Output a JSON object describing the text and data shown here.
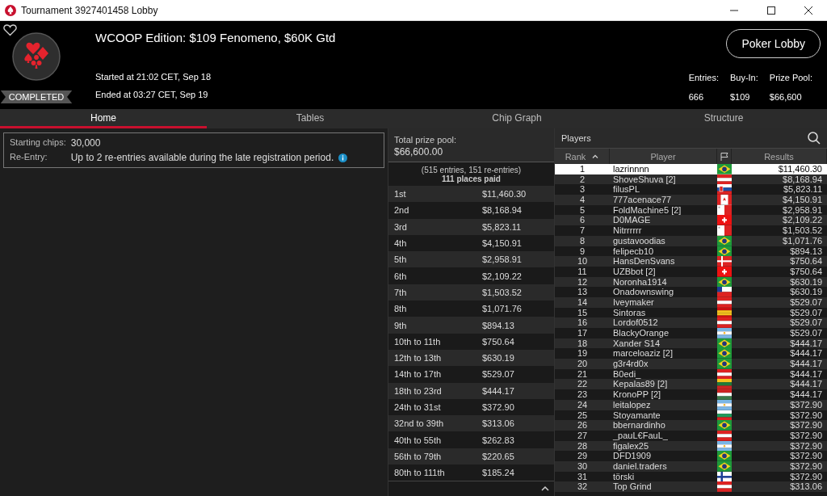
{
  "window": {
    "title": "Tournament 3927401458 Lobby"
  },
  "header": {
    "title": "WCOOP Edition: $109 Fenomeno, $60K Gtd",
    "status": "COMPLETED",
    "started": "Started at 21:02 CET, Sep 18",
    "ended": "Ended at 03:27 CET, Sep 19",
    "lobby_button": "Poker Lobby",
    "favorite": false,
    "stats": [
      {
        "label": "Entries:",
        "value": "666"
      },
      {
        "label": "Buy-In:",
        "value": "$109"
      },
      {
        "label": "Prize Pool:",
        "value": "$66,600"
      }
    ]
  },
  "tabs": [
    {
      "label": "Home",
      "selected": true
    },
    {
      "label": "Tables",
      "selected": false
    },
    {
      "label": "Chip Graph",
      "selected": false
    },
    {
      "label": "Structure",
      "selected": false
    }
  ],
  "info": [
    {
      "label": "Starting chips:",
      "value": "30,000",
      "info": false
    },
    {
      "label": "Re-Entry:",
      "value": "Up to 2 re-entries available during the late registration period.",
      "info": true
    }
  ],
  "prizes": {
    "total_label": "Total prize pool:",
    "total": "$66,600.00",
    "entries_note": "(515 entries, 151 re-entries)",
    "places_paid": "111 places paid",
    "rows": [
      {
        "place": "1st",
        "amount": "$11,460.30"
      },
      {
        "place": "2nd",
        "amount": "$8,168.94"
      },
      {
        "place": "3rd",
        "amount": "$5,823.11"
      },
      {
        "place": "4th",
        "amount": "$4,150.91"
      },
      {
        "place": "5th",
        "amount": "$2,958.91"
      },
      {
        "place": "6th",
        "amount": "$2,109.22"
      },
      {
        "place": "7th",
        "amount": "$1,503.52"
      },
      {
        "place": "8th",
        "amount": "$1,071.76"
      },
      {
        "place": "9th",
        "amount": "$894.13"
      },
      {
        "place": "10th to 11th",
        "amount": "$750.64"
      },
      {
        "place": "12th to 13th",
        "amount": "$630.19"
      },
      {
        "place": "14th to 17th",
        "amount": "$529.07"
      },
      {
        "place": "18th to 23rd",
        "amount": "$444.17"
      },
      {
        "place": "24th to 31st",
        "amount": "$372.90"
      },
      {
        "place": "32nd to 39th",
        "amount": "$313.06"
      },
      {
        "place": "40th to 55th",
        "amount": "$262.83"
      },
      {
        "place": "56th to 79th",
        "amount": "$220.65"
      },
      {
        "place": "80th to 111th",
        "amount": "$185.24"
      }
    ]
  },
  "players": {
    "title": "Players",
    "columns": [
      "Rank",
      "Player",
      "Results"
    ],
    "rows": [
      {
        "rank": "1",
        "name": "lazrinnnn",
        "kind": "br",
        "result": "$11,460.30",
        "selected": true
      },
      {
        "rank": "2",
        "name": "ShoveShuva [2]",
        "kind": "at",
        "result": "$8,168.94",
        "selected": false
      },
      {
        "rank": "3",
        "name": "filusPL",
        "kind": "sk",
        "result": "$5,823.11",
        "selected": false
      },
      {
        "rank": "4",
        "name": "777acenace77",
        "kind": "ca",
        "result": "$4,150.91",
        "selected": false
      },
      {
        "rank": "5",
        "name": "FoldMachine5 [2]",
        "kind": "mt",
        "result": "$2,958.91",
        "selected": false
      },
      {
        "rank": "6",
        "name": "D0MAGE",
        "kind": "ch",
        "result": "$2,109.22",
        "selected": false
      },
      {
        "rank": "7",
        "name": "Nitrrrrrr",
        "kind": "mt",
        "result": "$1,503.52",
        "selected": false
      },
      {
        "rank": "8",
        "name": "gustavoodias",
        "kind": "br",
        "result": "$1,071.76",
        "selected": false
      },
      {
        "rank": "9",
        "name": "felipecb10",
        "kind": "br",
        "result": "$894.13",
        "selected": false
      },
      {
        "rank": "10",
        "name": "HansDenSvans",
        "kind": "dk",
        "result": "$750.64",
        "selected": false
      },
      {
        "rank": "11",
        "name": "UZBbot [2]",
        "kind": "ch",
        "result": "$750.64",
        "selected": false
      },
      {
        "rank": "12",
        "name": "Noronha1914",
        "kind": "br",
        "result": "$630.19",
        "selected": false
      },
      {
        "rank": "13",
        "name": "Onadownswing",
        "kind": "cl",
        "result": "$630.19",
        "selected": false
      },
      {
        "rank": "14",
        "name": "Iveymaker",
        "kind": "at",
        "result": "$529.07",
        "selected": false
      },
      {
        "rank": "15",
        "name": "Sintoras",
        "kind": "es",
        "result": "$529.07",
        "selected": false
      },
      {
        "rank": "16",
        "name": "Lordof0512",
        "kind": "at",
        "result": "$529.07",
        "selected": false
      },
      {
        "rank": "17",
        "name": "BlackyOrange",
        "kind": "ar",
        "result": "$529.07",
        "selected": false
      },
      {
        "rank": "18",
        "name": "Xander S14",
        "kind": "br",
        "result": "$444.17",
        "selected": false
      },
      {
        "rank": "19",
        "name": "marceloaziz [2]",
        "kind": "br",
        "result": "$444.17",
        "selected": false
      },
      {
        "rank": "20",
        "name": "g3r4rd0x",
        "kind": "br",
        "result": "$444.17",
        "selected": false
      },
      {
        "rank": "21",
        "name": "B0edi_",
        "kind": "at",
        "result": "$444.17",
        "selected": false
      },
      {
        "rank": "22",
        "name": "Kepalas89 [2]",
        "kind": "lt",
        "result": "$444.17",
        "selected": false
      },
      {
        "rank": "23",
        "name": "KronoPP [2]",
        "kind": "hu",
        "result": "$444.17",
        "selected": false
      },
      {
        "rank": "24",
        "name": "leitalopez",
        "kind": "ar",
        "result": "$372.90",
        "selected": false
      },
      {
        "rank": "25",
        "name": "Stoyamante",
        "kind": "bg",
        "result": "$372.90",
        "selected": false
      },
      {
        "rank": "26",
        "name": "bbernardinho",
        "kind": "br",
        "result": "$372.90",
        "selected": false
      },
      {
        "rank": "27",
        "name": "_pauL€FauL_",
        "kind": "at",
        "result": "$372.90",
        "selected": false
      },
      {
        "rank": "28",
        "name": "figalex25",
        "kind": "ar",
        "result": "$372.90",
        "selected": false
      },
      {
        "rank": "29",
        "name": "DFD1909",
        "kind": "br",
        "result": "$372.90",
        "selected": false
      },
      {
        "rank": "30",
        "name": "daniel.traders",
        "kind": "br",
        "result": "$372.90",
        "selected": false
      },
      {
        "rank": "31",
        "name": "törski",
        "kind": "fi",
        "result": "$372.90",
        "selected": false
      },
      {
        "rank": "32",
        "name": "Top Grind",
        "kind": "at",
        "result": "$313.06",
        "selected": false
      }
    ]
  }
}
